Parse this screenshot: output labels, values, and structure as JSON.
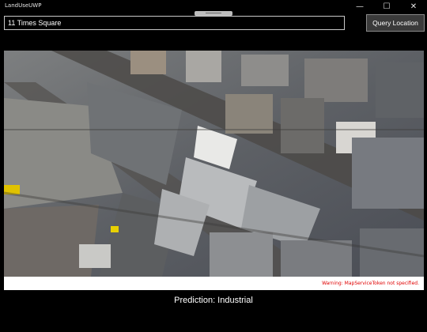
{
  "app": {
    "title": "LandUseUWP",
    "window_controls": {
      "minimize": "—",
      "maximize": "☐",
      "close": "✕"
    }
  },
  "search": {
    "value": "11 Times Square"
  },
  "toolbar": {
    "query_label": "Query Location"
  },
  "map": {
    "warning": "Warning: MapServiceToken not specified."
  },
  "result": {
    "prediction": "Prediction: Industrial"
  }
}
